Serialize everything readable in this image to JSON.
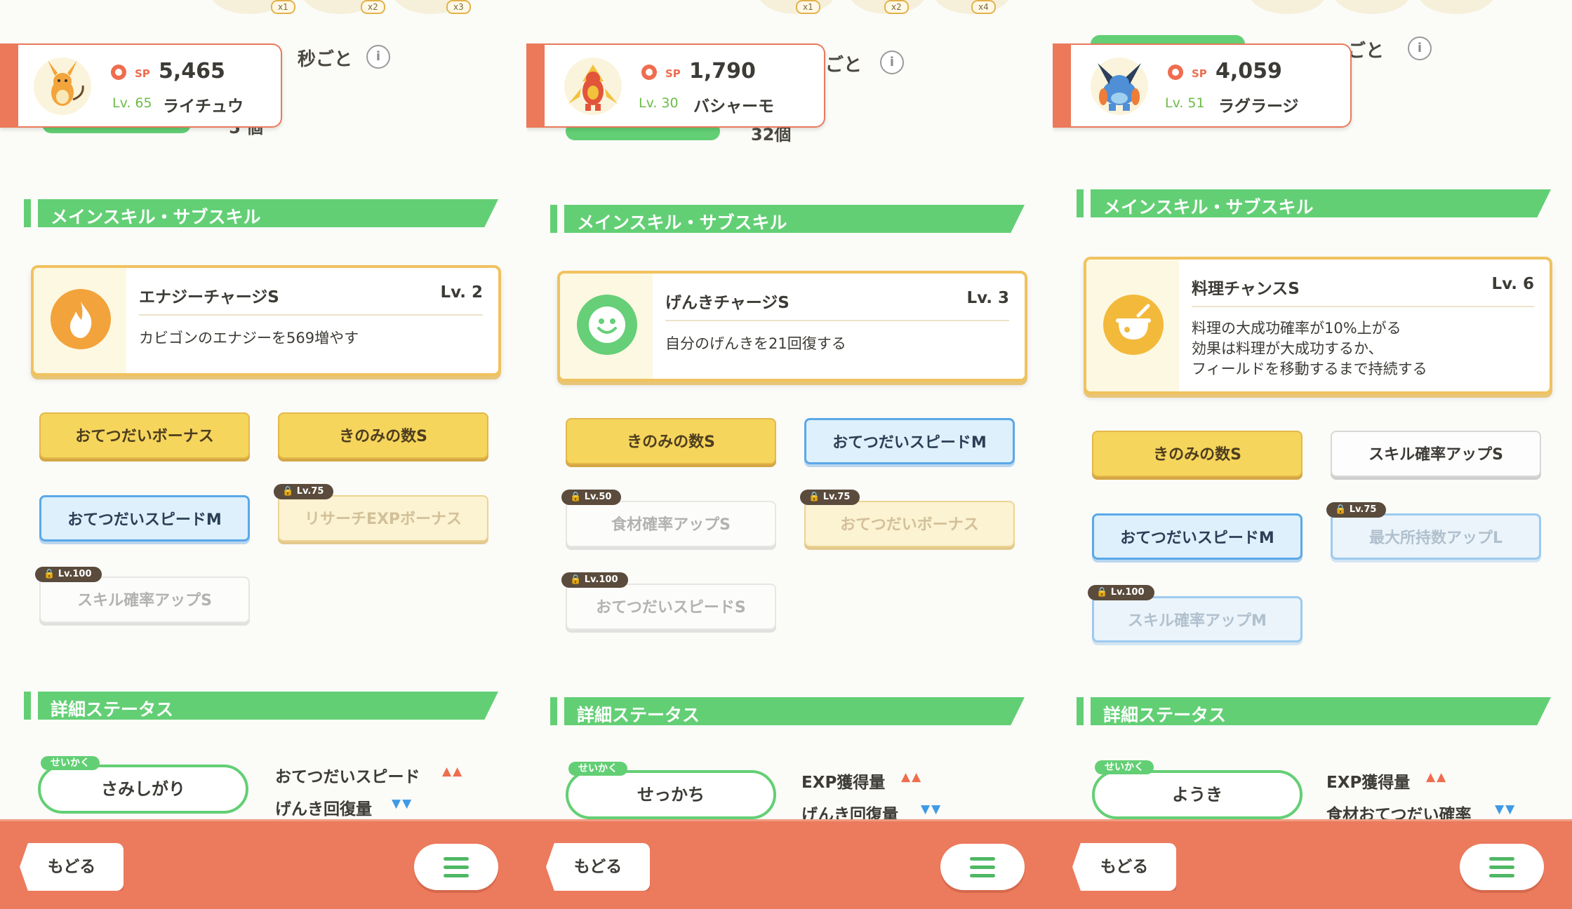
{
  "panels": [
    {
      "top_text": "秒ごと",
      "top_tags": [
        "x1",
        "x2",
        "x3"
      ],
      "top_partial": "5 個",
      "pokemon": {
        "sp_label": "SP",
        "sp": "5,465",
        "level": "Lv. 65",
        "name": "ライチュウ"
      },
      "main_section_title": "メインスキル・サブスキル",
      "skill": {
        "name": "エナジーチャージS",
        "level": "Lv. 2",
        "description": "カビゴンのエナジーを569増やす"
      },
      "subskills": [
        {
          "label": "おてつだいボーナス",
          "style": "gold",
          "locked": false
        },
        {
          "label": "きのみの数S",
          "style": "gold",
          "locked": false
        },
        {
          "label": "おてつだいスピードM",
          "style": "blue",
          "locked": false
        },
        {
          "label": "リサーチEXPボーナス",
          "style": "gold",
          "locked": true,
          "lock": "Lv.75"
        },
        {
          "label": "スキル確率アップS",
          "style": "white",
          "locked": true,
          "lock": "Lv.100"
        }
      ],
      "detail_section_title": "詳細ステータス",
      "nature_label": "せいかく",
      "nature": "さみしがり",
      "stat_up": "おてつだいスピード",
      "stat_down": "げんき回復量"
    },
    {
      "top_text": "ごと",
      "top_tags": [
        "x1",
        "x2",
        "x4"
      ],
      "top_partial": "32個",
      "pokemon": {
        "sp_label": "SP",
        "sp": "1,790",
        "level": "Lv. 30",
        "name": "バシャーモ"
      },
      "main_section_title": "メインスキル・サブスキル",
      "skill": {
        "name": "げんきチャージS",
        "level": "Lv. 3",
        "description": "自分のげんきを21回復する"
      },
      "subskills": [
        {
          "label": "きのみの数S",
          "style": "gold",
          "locked": false
        },
        {
          "label": "おてつだいスピードM",
          "style": "blue",
          "locked": false
        },
        {
          "label": "食材確率アップS",
          "style": "white",
          "locked": true,
          "lock": "Lv.50"
        },
        {
          "label": "おてつだいボーナス",
          "style": "gold",
          "locked": true,
          "lock": "Lv.75"
        },
        {
          "label": "おてつだいスピードS",
          "style": "white",
          "locked": true,
          "lock": "Lv.100"
        }
      ],
      "detail_section_title": "詳細ステータス",
      "nature_label": "せいかく",
      "nature": "せっかち",
      "stat_up": "EXP獲得量",
      "stat_down": "げんき回復量"
    },
    {
      "top_text": "ごと",
      "top_tags": [],
      "top_partial": "",
      "pokemon": {
        "sp_label": "SP",
        "sp": "4,059",
        "level": "Lv. 51",
        "name": "ラグラージ"
      },
      "main_section_title": "メインスキル・サブスキル",
      "skill": {
        "name": "料理チャンスS",
        "level": "Lv. 6",
        "description": "料理の大成功確率が10%上がる\n効果は料理が大成功するか、\nフィールドを移動するまで持続する"
      },
      "subskills": [
        {
          "label": "きのみの数S",
          "style": "gold",
          "locked": false
        },
        {
          "label": "スキル確率アップS",
          "style": "white",
          "locked": false
        },
        {
          "label": "おてつだいスピードM",
          "style": "blue",
          "locked": false
        },
        {
          "label": "最大所持数アップL",
          "style": "blue",
          "locked": true,
          "lock": "Lv.75"
        },
        {
          "label": "スキル確率アップM",
          "style": "blue",
          "locked": true,
          "lock": "Lv.100"
        }
      ],
      "detail_section_title": "詳細ステータス",
      "nature_label": "せいかく",
      "nature": "ようき",
      "stat_up": "EXP獲得量",
      "stat_down": "食材おてつだい確率"
    }
  ],
  "nav": {
    "back_label": "もどる"
  },
  "colors": {
    "accent_green": "#63cf75",
    "coral": "#ec7a5c",
    "gold": "#f6d55c",
    "blue": "#5aa8e8"
  }
}
